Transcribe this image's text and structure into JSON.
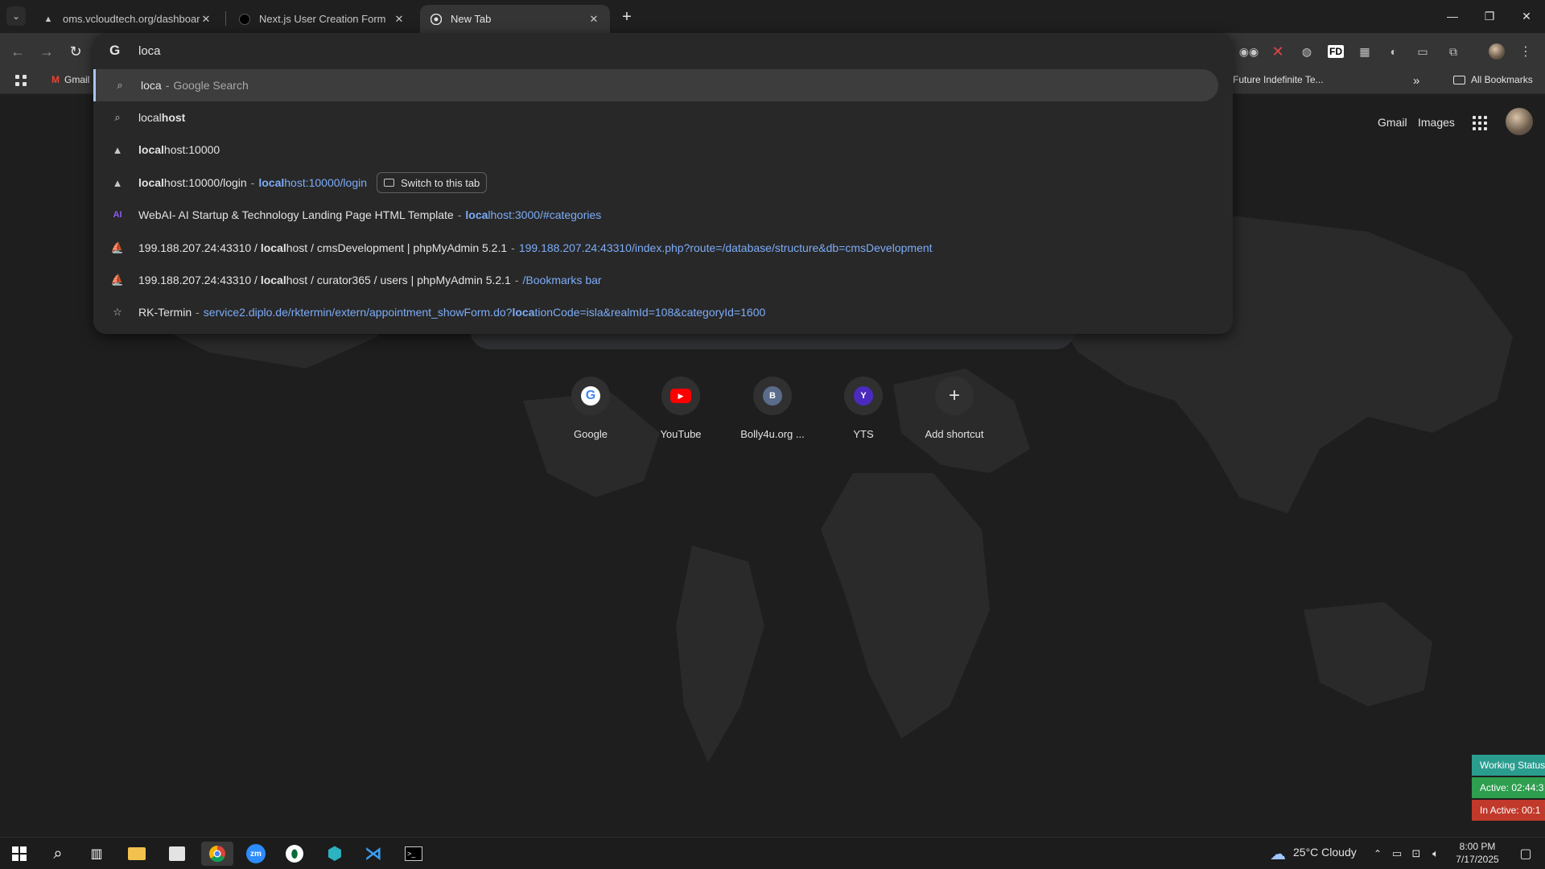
{
  "tabs": [
    {
      "title": "oms.vcloudtech.org/dashboard",
      "icon": "triangle-icon"
    },
    {
      "title": "Next.js User Creation Form",
      "icon": "nextjs-icon"
    },
    {
      "title": "New Tab",
      "icon": "chrome-icon",
      "active": true
    }
  ],
  "window_controls": {
    "minimize": "—",
    "restore": "❐",
    "close": "✕"
  },
  "bookmarks": {
    "gmail": "Gmail",
    "future": "Future Indefinite Te...",
    "overflow": "»",
    "all": "All Bookmarks"
  },
  "toolbar_ext": {
    "fd": "FD"
  },
  "omnibox": {
    "input_value": "loca",
    "rows": [
      {
        "icon": "search-icon",
        "match": "loca",
        "rest": "",
        "desc": "Google Search"
      },
      {
        "icon": "search-icon",
        "match": "local",
        "rest": "host"
      },
      {
        "icon": "triangle-icon",
        "url_match": "local",
        "url_rest": "host:10000"
      },
      {
        "icon": "triangle-icon",
        "title_match": "local",
        "title_rest": "host:10000/login",
        "url_match": "local",
        "url_rest": "host:10000/login",
        "button": "Switch to this tab"
      },
      {
        "icon": "ai-icon",
        "title": "WebAI- AI Startup & Technology Landing Page HTML Template",
        "url_match": "loca",
        "url_rest": "lhost:3000/#categories"
      },
      {
        "icon": "phpmyadmin-icon",
        "title_pre": "199.188.207.24:43310 / ",
        "title_match": "local",
        "title_post": "host / cmsDevelopment | phpMyAdmin 5.2.1",
        "url": "199.188.207.24:43310/index.php?route=/database/structure&db=cmsDevelopment"
      },
      {
        "icon": "phpmyadmin-icon",
        "title_pre": "199.188.207.24:43310 / ",
        "title_match": "local",
        "title_post": "host / curator365 / users | phpMyAdmin 5.2.1",
        "url": "/Bookmarks bar"
      },
      {
        "icon": "star-icon",
        "title": "RK-Termin",
        "url_pre": "service2.diplo.de/rktermin/extern/appointment_showForm.do?",
        "url_match": "loca",
        "url_post": "tionCode=isla&realmId=108&categoryId=1600"
      }
    ],
    "separator": "-"
  },
  "ntp": {
    "gmail": "Gmail",
    "images": "Images",
    "shortcuts": [
      {
        "label": "Google",
        "icon": "google-icon"
      },
      {
        "label": "YouTube",
        "icon": "youtube-icon"
      },
      {
        "label": "Bolly4u.org ...",
        "icon": "b-letter-icon",
        "letter": "B"
      },
      {
        "label": "YTS",
        "icon": "y-letter-icon",
        "letter": "Y"
      },
      {
        "label": "Add shortcut",
        "icon": "plus-icon"
      }
    ]
  },
  "status_widget": {
    "working": "Working Status",
    "active": "Active: 02:44:3",
    "inactive": "In Active: 00:1"
  },
  "taskbar": {
    "weather": "25°C  Cloudy",
    "time": "8:00 PM",
    "date": "7/17/2025"
  },
  "colors": {
    "accent_blue": "#7cacf8",
    "widget_teal": "#2a9d8f",
    "widget_green": "#2e9e4f",
    "widget_red": "#c0392b"
  }
}
